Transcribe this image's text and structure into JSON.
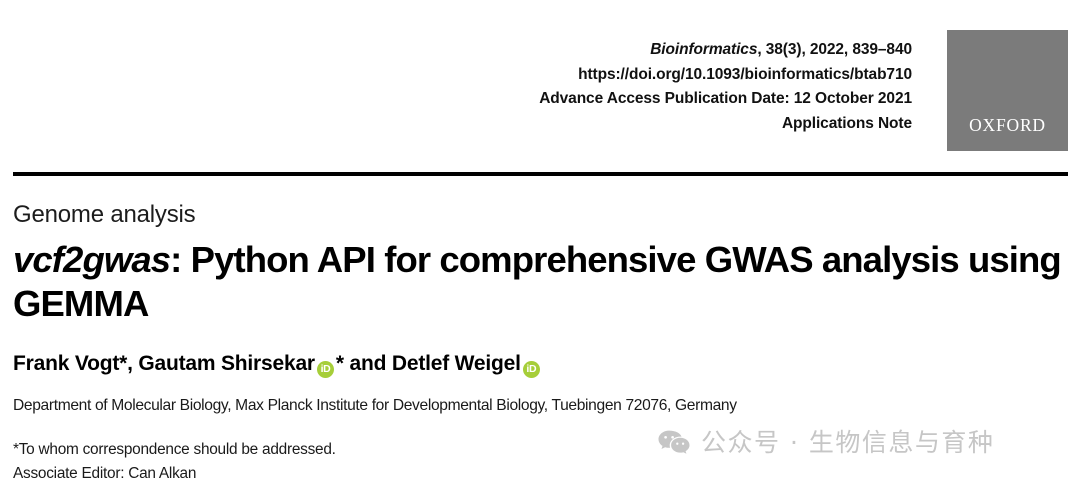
{
  "masthead": {
    "journal_name": "Bioinformatics",
    "citation_rest": ", 38(3), 2022, 839–840",
    "doi": "https://doi.org/10.1093/bioinformatics/btab710",
    "advance_access": "Advance Access Publication Date: 12 October 2021",
    "article_type": "Applications Note",
    "publisher_logo_text": "OXFORD",
    "logo_background_color": "#7b7b7b",
    "rule_color": "#000000"
  },
  "article": {
    "section_label": "Genome analysis",
    "title_tool": "vcf2gwas",
    "title_rest": ": Python API for comprehensive GWAS analysis using GEMMA",
    "authors": {
      "segment_1": "Frank Vogt*, Gautam Shirsekar",
      "orcid_label_1": "iD",
      "segment_2": "* and Detlef Weigel",
      "orcid_label_2": "iD",
      "orcid_color": "#a6ce39"
    },
    "affiliation": "Department of Molecular Biology, Max Planck Institute for Developmental Biology, Tuebingen 72076, Germany",
    "footnotes": [
      "*To whom correspondence should be addressed.",
      "Associate Editor: Can Alkan"
    ]
  },
  "watermark": {
    "text": "公众号 · 生物信息与育种",
    "icon": "wechat-icon",
    "color": "#c6c6c6"
  }
}
